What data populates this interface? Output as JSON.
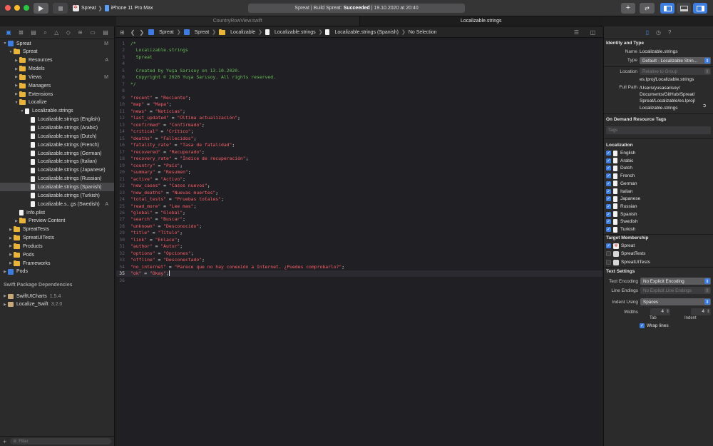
{
  "toolbar": {
    "scheme_target": "Spreat",
    "scheme_device": "iPhone 11 Pro Max",
    "status_prefix": "Spreat | Build Spreat:",
    "status_result": "Succeeded",
    "status_suffix": "| 19.10.2020 at 20:40"
  },
  "tabs": [
    {
      "label": "CountryRowView.swift",
      "active": false
    },
    {
      "label": "Localizable.strings",
      "active": true
    }
  ],
  "navigator": {
    "tree": [
      {
        "label": "Spreat",
        "level": 0,
        "icon": "project",
        "disclosure": "open",
        "badge": "M"
      },
      {
        "label": "Spreat",
        "level": 1,
        "icon": "folder",
        "disclosure": "open",
        "badge": ""
      },
      {
        "label": "Resources",
        "level": 2,
        "icon": "folder",
        "disclosure": "closed",
        "badge": "A"
      },
      {
        "label": "Models",
        "level": 2,
        "icon": "folder",
        "disclosure": "closed",
        "badge": ""
      },
      {
        "label": "Views",
        "level": 2,
        "icon": "folder",
        "disclosure": "closed",
        "badge": "M"
      },
      {
        "label": "Managers",
        "level": 2,
        "icon": "folder",
        "disclosure": "closed",
        "badge": ""
      },
      {
        "label": "Extensions",
        "level": 2,
        "icon": "folder",
        "disclosure": "closed",
        "badge": ""
      },
      {
        "label": "Localize",
        "level": 2,
        "icon": "folder",
        "disclosure": "open",
        "badge": ""
      },
      {
        "label": "Localizable.strings",
        "level": 3,
        "icon": "file",
        "disclosure": "open",
        "badge": ""
      },
      {
        "label": "Localizable.strings (English)",
        "level": 4,
        "icon": "file",
        "disclosure": "",
        "badge": ""
      },
      {
        "label": "Localizable.strings (Arabic)",
        "level": 4,
        "icon": "file",
        "disclosure": "",
        "badge": ""
      },
      {
        "label": "Localizable.strings (Dutch)",
        "level": 4,
        "icon": "file",
        "disclosure": "",
        "badge": ""
      },
      {
        "label": "Localizable.strings (French)",
        "level": 4,
        "icon": "file",
        "disclosure": "",
        "badge": ""
      },
      {
        "label": "Localizable.strings (German)",
        "level": 4,
        "icon": "file",
        "disclosure": "",
        "badge": ""
      },
      {
        "label": "Localizable.strings (Italian)",
        "level": 4,
        "icon": "file",
        "disclosure": "",
        "badge": ""
      },
      {
        "label": "Localizable.strings (Japanese)",
        "level": 4,
        "icon": "file",
        "disclosure": "",
        "badge": ""
      },
      {
        "label": "Localizable.strings (Russian)",
        "level": 4,
        "icon": "file",
        "disclosure": "",
        "badge": ""
      },
      {
        "label": "Localizable.strings (Spanish)",
        "level": 4,
        "icon": "file",
        "disclosure": "",
        "badge": "",
        "selected": true
      },
      {
        "label": "Localizable.strings (Turkish)",
        "level": 4,
        "icon": "file",
        "disclosure": "",
        "badge": ""
      },
      {
        "label": "Localizable.s...gs (Swedish)",
        "level": 4,
        "icon": "file",
        "disclosure": "",
        "badge": "A"
      },
      {
        "label": "Info.plist",
        "level": 2,
        "icon": "file",
        "disclosure": "",
        "badge": ""
      },
      {
        "label": "Preview Content",
        "level": 2,
        "icon": "folder",
        "disclosure": "closed",
        "badge": ""
      },
      {
        "label": "SpreatTests",
        "level": 1,
        "icon": "folder",
        "disclosure": "closed",
        "badge": ""
      },
      {
        "label": "SpreatUITests",
        "level": 1,
        "icon": "folder",
        "disclosure": "closed",
        "badge": ""
      },
      {
        "label": "Products",
        "level": 1,
        "icon": "folder",
        "disclosure": "closed",
        "badge": ""
      },
      {
        "label": "Pods",
        "level": 1,
        "icon": "folder",
        "disclosure": "closed",
        "badge": ""
      },
      {
        "label": "Frameworks",
        "level": 1,
        "icon": "folder",
        "disclosure": "closed",
        "badge": ""
      },
      {
        "label": "Pods",
        "level": 0,
        "icon": "project",
        "disclosure": "closed",
        "badge": ""
      }
    ],
    "packages_header": "Swift Package Dependencies",
    "packages": [
      {
        "name": "SwiftUICharts",
        "version": "1.5.4"
      },
      {
        "name": "Localize_Swift",
        "version": "3.2.0"
      }
    ],
    "filter_placeholder": "Filter"
  },
  "jumpbar": {
    "crumbs": [
      "Spreat",
      "Spreat",
      "Localizable",
      "Localizable.strings",
      "Localizable.strings (Spanish)",
      "No Selection"
    ]
  },
  "editor": {
    "current_line": 35,
    "lines": [
      {
        "n": "1",
        "parts": [
          {
            "t": "/*",
            "c": "comment"
          }
        ]
      },
      {
        "n": "2",
        "parts": [
          {
            "t": "  Localizable.strings",
            "c": "comment"
          }
        ]
      },
      {
        "n": "3",
        "parts": [
          {
            "t": "  Spreat",
            "c": "comment"
          }
        ]
      },
      {
        "n": "4",
        "parts": []
      },
      {
        "n": "5",
        "parts": [
          {
            "t": "  Created by Yuşa Sarısoy on 13.10.2020.",
            "c": "comment"
          }
        ]
      },
      {
        "n": "6",
        "parts": [
          {
            "t": "  Copyright © 2020 Yuşa Sarısoy. All rights reserved.",
            "c": "comment"
          }
        ]
      },
      {
        "n": "7",
        "parts": [
          {
            "t": "*/",
            "c": "comment"
          }
        ]
      },
      {
        "n": "8",
        "parts": []
      },
      {
        "n": "9",
        "parts": [
          {
            "t": "\"recent\"",
            "c": "str"
          },
          {
            "t": " = ",
            "c": "plain"
          },
          {
            "t": "\"Reciente\"",
            "c": "str"
          },
          {
            "t": ";",
            "c": "plain"
          }
        ]
      },
      {
        "n": "10",
        "parts": [
          {
            "t": "\"map\"",
            "c": "str"
          },
          {
            "t": " = ",
            "c": "plain"
          },
          {
            "t": "\"Mapa\"",
            "c": "str"
          },
          {
            "t": ";",
            "c": "plain"
          }
        ]
      },
      {
        "n": "11",
        "parts": [
          {
            "t": "\"news\"",
            "c": "str"
          },
          {
            "t": " = ",
            "c": "plain"
          },
          {
            "t": "\"Noticias\"",
            "c": "str"
          },
          {
            "t": ";",
            "c": "plain"
          }
        ]
      },
      {
        "n": "12",
        "parts": [
          {
            "t": "\"last_updated\"",
            "c": "str"
          },
          {
            "t": " = ",
            "c": "plain"
          },
          {
            "t": "\"Última actualización\"",
            "c": "str"
          },
          {
            "t": ";",
            "c": "plain"
          }
        ]
      },
      {
        "n": "13",
        "parts": [
          {
            "t": "\"confirmed\"",
            "c": "str"
          },
          {
            "t": " = ",
            "c": "plain"
          },
          {
            "t": "\"Confirmado\"",
            "c": "str"
          },
          {
            "t": ";",
            "c": "plain"
          }
        ]
      },
      {
        "n": "14",
        "parts": [
          {
            "t": "\"critical\"",
            "c": "str"
          },
          {
            "t": " = ",
            "c": "plain"
          },
          {
            "t": "\"Crítico\"",
            "c": "str"
          },
          {
            "t": ";",
            "c": "plain"
          }
        ]
      },
      {
        "n": "15",
        "parts": [
          {
            "t": "\"deaths\"",
            "c": "str"
          },
          {
            "t": " = ",
            "c": "plain"
          },
          {
            "t": "\"Fallecidos\"",
            "c": "str"
          },
          {
            "t": ";",
            "c": "plain"
          }
        ]
      },
      {
        "n": "16",
        "parts": [
          {
            "t": "\"fatality_rate\"",
            "c": "str"
          },
          {
            "t": " = ",
            "c": "plain"
          },
          {
            "t": "\"Tasa de fatalidad\"",
            "c": "str"
          },
          {
            "t": ";",
            "c": "plain"
          }
        ]
      },
      {
        "n": "17",
        "parts": [
          {
            "t": "\"recovered\"",
            "c": "str"
          },
          {
            "t": " = ",
            "c": "plain"
          },
          {
            "t": "\"Recuperado\"",
            "c": "str"
          },
          {
            "t": ";",
            "c": "plain"
          }
        ]
      },
      {
        "n": "18",
        "parts": [
          {
            "t": "\"recovery_rate\"",
            "c": "str"
          },
          {
            "t": " = ",
            "c": "plain"
          },
          {
            "t": "\"Índice de recuperación\"",
            "c": "str"
          },
          {
            "t": ";",
            "c": "plain"
          }
        ]
      },
      {
        "n": "19",
        "parts": [
          {
            "t": "\"country\"",
            "c": "str"
          },
          {
            "t": " = ",
            "c": "plain"
          },
          {
            "t": "\"País\"",
            "c": "str"
          },
          {
            "t": ";",
            "c": "plain"
          }
        ]
      },
      {
        "n": "20",
        "parts": [
          {
            "t": "\"summary\"",
            "c": "str"
          },
          {
            "t": " = ",
            "c": "plain"
          },
          {
            "t": "\"Resumen\"",
            "c": "str"
          },
          {
            "t": ";",
            "c": "plain"
          }
        ]
      },
      {
        "n": "21",
        "parts": [
          {
            "t": "\"active\"",
            "c": "str"
          },
          {
            "t": " = ",
            "c": "plain"
          },
          {
            "t": "\"Activo\"",
            "c": "str"
          },
          {
            "t": ";",
            "c": "plain"
          }
        ]
      },
      {
        "n": "22",
        "parts": [
          {
            "t": "\"new_cases\"",
            "c": "str"
          },
          {
            "t": " = ",
            "c": "plain"
          },
          {
            "t": "\"Casos nuevos\"",
            "c": "str"
          },
          {
            "t": ";",
            "c": "plain"
          }
        ]
      },
      {
        "n": "23",
        "parts": [
          {
            "t": "\"new_deaths\"",
            "c": "str"
          },
          {
            "t": " = ",
            "c": "plain"
          },
          {
            "t": "\"Nuevas muertes\"",
            "c": "str"
          },
          {
            "t": ";",
            "c": "plain"
          }
        ]
      },
      {
        "n": "24",
        "parts": [
          {
            "t": "\"total_tests\"",
            "c": "str"
          },
          {
            "t": " = ",
            "c": "plain"
          },
          {
            "t": "\"Pruebas totales\"",
            "c": "str"
          },
          {
            "t": ";",
            "c": "plain"
          }
        ]
      },
      {
        "n": "25",
        "parts": [
          {
            "t": "\"read_more\"",
            "c": "str"
          },
          {
            "t": " = ",
            "c": "plain"
          },
          {
            "t": "\"Lee mas\"",
            "c": "str"
          },
          {
            "t": ";",
            "c": "plain"
          }
        ]
      },
      {
        "n": "26",
        "parts": [
          {
            "t": "\"global\"",
            "c": "str"
          },
          {
            "t": " = ",
            "c": "plain"
          },
          {
            "t": "\"Global\"",
            "c": "str"
          },
          {
            "t": ";",
            "c": "plain"
          }
        ]
      },
      {
        "n": "27",
        "parts": [
          {
            "t": "\"search\"",
            "c": "str"
          },
          {
            "t": " = ",
            "c": "plain"
          },
          {
            "t": "\"Buscar\"",
            "c": "str"
          },
          {
            "t": ";",
            "c": "plain"
          }
        ]
      },
      {
        "n": "28",
        "parts": [
          {
            "t": "\"unknown\"",
            "c": "str"
          },
          {
            "t": " = ",
            "c": "plain"
          },
          {
            "t": "\"Desconocido\"",
            "c": "str"
          },
          {
            "t": ";",
            "c": "plain"
          }
        ]
      },
      {
        "n": "29",
        "parts": [
          {
            "t": "\"title\"",
            "c": "str"
          },
          {
            "t": " = ",
            "c": "plain"
          },
          {
            "t": "\"Título\"",
            "c": "str"
          },
          {
            "t": ";",
            "c": "plain"
          }
        ]
      },
      {
        "n": "30",
        "parts": [
          {
            "t": "\"link\"",
            "c": "str"
          },
          {
            "t": " = ",
            "c": "plain"
          },
          {
            "t": "\"Enlace\"",
            "c": "str"
          },
          {
            "t": ";",
            "c": "plain"
          }
        ]
      },
      {
        "n": "31",
        "parts": [
          {
            "t": "\"author\"",
            "c": "str"
          },
          {
            "t": " = ",
            "c": "plain"
          },
          {
            "t": "\"Autor\"",
            "c": "str"
          },
          {
            "t": ";",
            "c": "plain"
          }
        ]
      },
      {
        "n": "32",
        "parts": [
          {
            "t": "\"options\"",
            "c": "str"
          },
          {
            "t": " = ",
            "c": "plain"
          },
          {
            "t": "\"Opciones\"",
            "c": "str"
          },
          {
            "t": ";",
            "c": "plain"
          }
        ]
      },
      {
        "n": "33",
        "parts": [
          {
            "t": "\"offline\"",
            "c": "str"
          },
          {
            "t": " = ",
            "c": "plain"
          },
          {
            "t": "\"Desconectado\"",
            "c": "str"
          },
          {
            "t": ";",
            "c": "plain"
          }
        ]
      },
      {
        "n": "34",
        "parts": [
          {
            "t": "\"no_internet\"",
            "c": "str"
          },
          {
            "t": " = ",
            "c": "plain"
          },
          {
            "t": "\"Parece que no hay conexión a Internet. ¿Puedes comprobarlo?\"",
            "c": "str"
          },
          {
            "t": ";",
            "c": "plain"
          }
        ]
      },
      {
        "n": "35",
        "parts": [
          {
            "t": "\"ok\"",
            "c": "str"
          },
          {
            "t": " = ",
            "c": "plain"
          },
          {
            "t": "\"Okay\"",
            "c": "str"
          },
          {
            "t": ";",
            "c": "plain"
          }
        ]
      },
      {
        "n": "36",
        "parts": []
      }
    ]
  },
  "inspector": {
    "identity_title": "Identity and Type",
    "name_label": "Name",
    "name_value": "Localizable.strings",
    "type_label": "Type",
    "type_value": "Default - Localizable Strin...",
    "location_label": "Location",
    "location_value": "Relative to Group",
    "location_file": "es.lproj/Localizable.strings",
    "fullpath_label": "Full Path",
    "fullpath_value": [
      "/Users/yusasarisoy/",
      "Documents/GitHub/Spreat/",
      "Spreat/Localizable/es.lproj/",
      "Localizable.strings"
    ],
    "odr_title": "On Demand Resource Tags",
    "tags_placeholder": "Tags",
    "localization_title": "Localization",
    "localizations": [
      {
        "name": "English",
        "checked": true
      },
      {
        "name": "Arabic",
        "checked": true
      },
      {
        "name": "Dutch",
        "checked": true
      },
      {
        "name": "French",
        "checked": true
      },
      {
        "name": "German",
        "checked": true
      },
      {
        "name": "Italian",
        "checked": true
      },
      {
        "name": "Japanese",
        "checked": true
      },
      {
        "name": "Russian",
        "checked": true
      },
      {
        "name": "Spanish",
        "checked": true
      },
      {
        "name": "Swedish",
        "checked": true
      },
      {
        "name": "Turkish",
        "checked": true
      }
    ],
    "target_title": "Target Membership",
    "targets": [
      {
        "name": "Spreat",
        "checked": true,
        "icon": "app"
      },
      {
        "name": "SpreatTests",
        "checked": false,
        "icon": "test"
      },
      {
        "name": "SpreatUITests",
        "checked": false,
        "icon": "test"
      }
    ],
    "text_settings_title": "Text Settings",
    "encoding_label": "Text Encoding",
    "encoding_value": "No Explicit Encoding",
    "line_endings_label": "Line Endings",
    "line_endings_value": "No Explicit Line Endings",
    "indent_label": "Indent Using",
    "indent_value": "Spaces",
    "widths_label": "Widths",
    "tab_width": "4",
    "indent_width": "4",
    "tab_sublabel": "Tab",
    "indent_sublabel": "Indent",
    "wrap_label": "Wrap lines",
    "wrap_checked": true
  },
  "colors": {
    "accent": "#3d7de0",
    "string": "#fc5f67",
    "comment": "#6bbf59",
    "folder": "#e9b43a"
  }
}
